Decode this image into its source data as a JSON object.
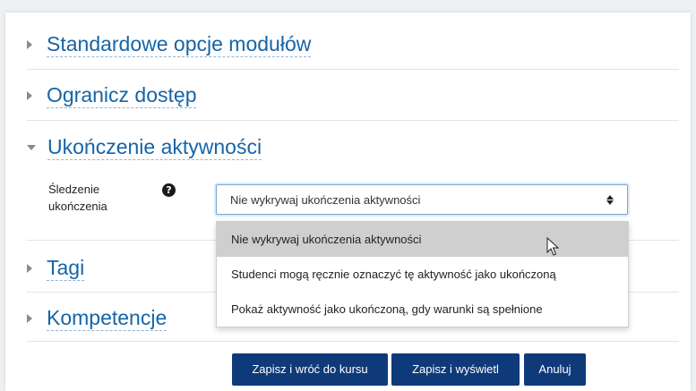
{
  "sections": [
    {
      "title": "Standardowe opcje modułów",
      "state": "collapsed"
    },
    {
      "title": "Ogranicz dostęp",
      "state": "collapsed"
    },
    {
      "title": "Ukończenie aktywności",
      "state": "expanded"
    },
    {
      "title": "Tagi",
      "state": "collapsed"
    },
    {
      "title": "Kompetencje",
      "state": "collapsed"
    }
  ],
  "completion": {
    "label_line1": "Śledzenie",
    "label_line2": "ukończenia",
    "help_icon": "question-circle-icon",
    "selected_value": "Nie wykrywaj ukończenia aktywności",
    "options": [
      "Nie wykrywaj ukończenia aktywności",
      "Studenci mogą ręcznie oznaczyć tę aktywność jako ukończoną",
      "Pokaż aktywność jako ukończoną, gdy warunki są spełnione"
    ]
  },
  "buttons": {
    "save_return": "Zapisz i wróć do kursu",
    "save_display": "Zapisz i wyświetl",
    "cancel": "Anuluj"
  },
  "colors": {
    "link": "#1565a8",
    "button": "#0f3a7a",
    "selected_option": "#cfcfcf"
  }
}
